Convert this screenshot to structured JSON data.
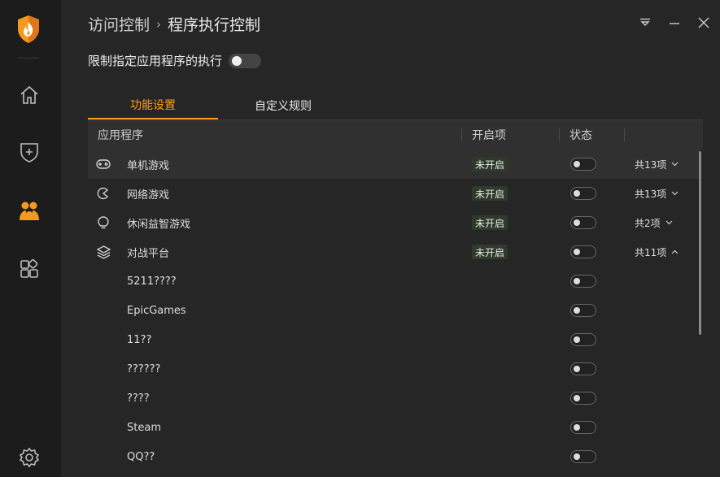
{
  "header": {
    "parent": "访问控制",
    "separator": "›",
    "current": "程序执行控制"
  },
  "restrict": {
    "label": "限制指定应用程序的执行",
    "enabled": false
  },
  "tabs": [
    {
      "label": "功能设置",
      "active": true
    },
    {
      "label": "自定义规则",
      "active": false
    }
  ],
  "table": {
    "columns": [
      "应用程序",
      "开启项",
      "状态"
    ],
    "rows": [
      {
        "icon": "gamepad-icon",
        "name": "单机游戏",
        "badge": "未开启",
        "count": "共13项",
        "expanded": false
      },
      {
        "icon": "pacman-icon",
        "name": "网络游戏",
        "badge": "未开启",
        "count": "共13项",
        "expanded": false
      },
      {
        "icon": "lightbulb-icon",
        "name": "休闲益智游戏",
        "badge": "未开启",
        "count": "共2项",
        "expanded": false
      },
      {
        "icon": "layers-icon",
        "name": "对战平台",
        "badge": "未开启",
        "count": "共11项",
        "expanded": true
      }
    ],
    "children": [
      {
        "name": "5211????"
      },
      {
        "name": "EpicGames"
      },
      {
        "name": "11??"
      },
      {
        "name": "??????"
      },
      {
        "name": "????"
      },
      {
        "name": "Steam"
      },
      {
        "name": "QQ??"
      }
    ]
  },
  "colors": {
    "accent": "#ff9b1a",
    "background": "#262626",
    "sidebar": "#1c1c1c"
  }
}
